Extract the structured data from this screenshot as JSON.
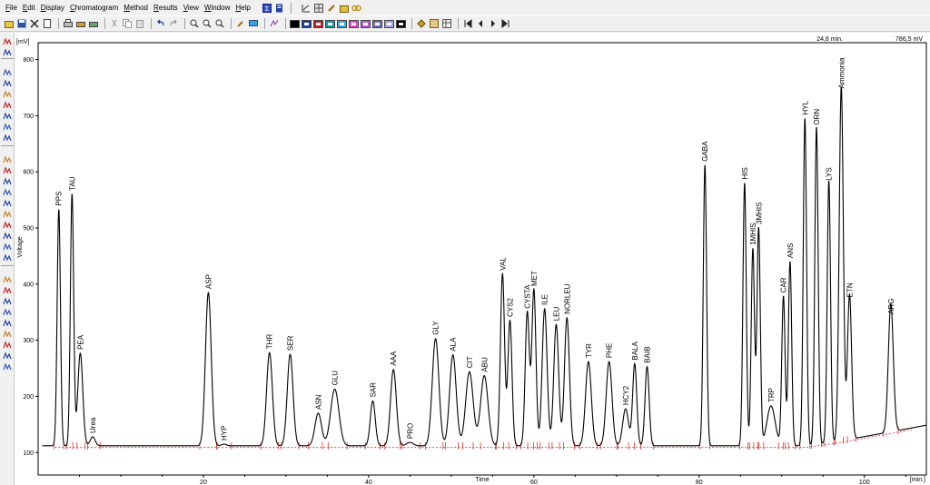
{
  "menu": [
    {
      "label": "File",
      "ul": "F",
      "rest": "ile"
    },
    {
      "label": "Edit",
      "ul": "E",
      "rest": "dit"
    },
    {
      "label": "Display",
      "ul": "D",
      "rest": "isplay"
    },
    {
      "label": "Chromatogram",
      "ul": "C",
      "rest": "hromatogram"
    },
    {
      "label": "Method",
      "ul": "M",
      "rest": "ethod"
    },
    {
      "label": "Results",
      "ul": "R",
      "rest": "esults"
    },
    {
      "label": "View",
      "ul": "V",
      "rest": "iew"
    },
    {
      "label": "Window",
      "ul": "W",
      "rest": "indow"
    },
    {
      "label": "Help",
      "ul": "H",
      "rest": "elp"
    }
  ],
  "colors": {
    "trace": "#000000",
    "baseline": "#e03030",
    "swatches": [
      "#000000",
      "#1a3fa0",
      "#c02020",
      "#1a9aa0",
      "#3aa8e0",
      "#e050c0",
      "#b060d0",
      "#7070c0",
      "#a0a0e0",
      "#000000"
    ]
  },
  "status": {
    "time": "24,8 min.",
    "voltage": "786,5 mV"
  },
  "chart_data": {
    "type": "line",
    "xlabel": "Time",
    "ylabel": "Voltage",
    "yunit": "[mV]",
    "xunit": "[min.]",
    "xlim": [
      0,
      107.5
    ],
    "ylim": [
      60,
      830
    ],
    "xticks": [
      20,
      40,
      60,
      80,
      100
    ],
    "yticks": [
      100,
      200,
      300,
      400,
      500,
      600,
      700,
      800
    ],
    "baseline_mv": 112,
    "peaks": [
      {
        "name": "PPS",
        "t": 2.5,
        "h": 533,
        "w": 0.2
      },
      {
        "name": "TAU",
        "t": 4.1,
        "h": 560,
        "w": 0.2
      },
      {
        "name": "PEA",
        "t": 5.1,
        "h": 277,
        "w": 0.3
      },
      {
        "name": "Urea",
        "t": 6.6,
        "h": 128,
        "w": 0.3
      },
      {
        "name": "ASP",
        "t": 20.6,
        "h": 385,
        "w": 0.35
      },
      {
        "name": "HYP",
        "t": 22.5,
        "h": 115,
        "w": 0.3
      },
      {
        "name": "THR",
        "t": 28.0,
        "h": 278,
        "w": 0.35
      },
      {
        "name": "SER",
        "t": 30.5,
        "h": 275,
        "w": 0.35
      },
      {
        "name": "ASN",
        "t": 33.9,
        "h": 170,
        "w": 0.4
      },
      {
        "name": "GLU",
        "t": 35.9,
        "h": 213,
        "w": 0.5
      },
      {
        "name": "SAR",
        "t": 40.5,
        "h": 192,
        "w": 0.3
      },
      {
        "name": "AAA",
        "t": 43.0,
        "h": 248,
        "w": 0.35
      },
      {
        "name": "PRO",
        "t": 45.0,
        "h": 118,
        "w": 0.4
      },
      {
        "name": "GLY",
        "t": 48.1,
        "h": 303,
        "w": 0.4
      },
      {
        "name": "ALA",
        "t": 50.2,
        "h": 274,
        "w": 0.4
      },
      {
        "name": "CIT",
        "t": 52.2,
        "h": 244,
        "w": 0.45
      },
      {
        "name": "ABU",
        "t": 54.0,
        "h": 237,
        "w": 0.45
      },
      {
        "name": "VAL",
        "t": 56.2,
        "h": 418,
        "w": 0.25
      },
      {
        "name": "CYS2",
        "t": 57.1,
        "h": 335,
        "w": 0.25
      },
      {
        "name": "CYSTA",
        "t": 59.2,
        "h": 350,
        "w": 0.25
      },
      {
        "name": "MET",
        "t": 60.0,
        "h": 390,
        "w": 0.25
      },
      {
        "name": "ILE",
        "t": 61.3,
        "h": 356,
        "w": 0.3
      },
      {
        "name": "LEU",
        "t": 62.7,
        "h": 328,
        "w": 0.3
      },
      {
        "name": "NORLEU",
        "t": 64.0,
        "h": 340,
        "w": 0.3
      },
      {
        "name": "TYR",
        "t": 66.6,
        "h": 262,
        "w": 0.35
      },
      {
        "name": "PHE",
        "t": 69.1,
        "h": 262,
        "w": 0.35
      },
      {
        "name": "HCY2",
        "t": 71.1,
        "h": 178,
        "w": 0.35
      },
      {
        "name": "BALA",
        "t": 72.2,
        "h": 258,
        "w": 0.25
      },
      {
        "name": "BAIB",
        "t": 73.7,
        "h": 253,
        "w": 0.25
      },
      {
        "name": "GABA",
        "t": 80.7,
        "h": 612,
        "w": 0.2
      },
      {
        "name": "HIS",
        "t": 85.5,
        "h": 580,
        "w": 0.2
      },
      {
        "name": "1MHIS",
        "t": 86.5,
        "h": 463,
        "w": 0.2
      },
      {
        "name": "3MHIS",
        "t": 87.2,
        "h": 500,
        "w": 0.2
      },
      {
        "name": "TRP",
        "t": 88.7,
        "h": 183,
        "w": 0.5
      },
      {
        "name": "CAR",
        "t": 90.2,
        "h": 378,
        "w": 0.2
      },
      {
        "name": "ANS",
        "t": 91.0,
        "h": 440,
        "w": 0.2
      },
      {
        "name": "HYL",
        "t": 92.8,
        "h": 695,
        "w": 0.2
      },
      {
        "name": "ORN",
        "t": 94.2,
        "h": 677,
        "w": 0.2
      },
      {
        "name": "LYS",
        "t": 95.7,
        "h": 578,
        "w": 0.2
      },
      {
        "name": "Ammonia",
        "t": 97.2,
        "h": 742,
        "w": 0.25
      },
      {
        "name": "ETN",
        "t": 98.2,
        "h": 370,
        "w": 0.25
      },
      {
        "name": "ARG",
        "t": 103.2,
        "h": 340,
        "w": 0.3
      }
    ]
  }
}
